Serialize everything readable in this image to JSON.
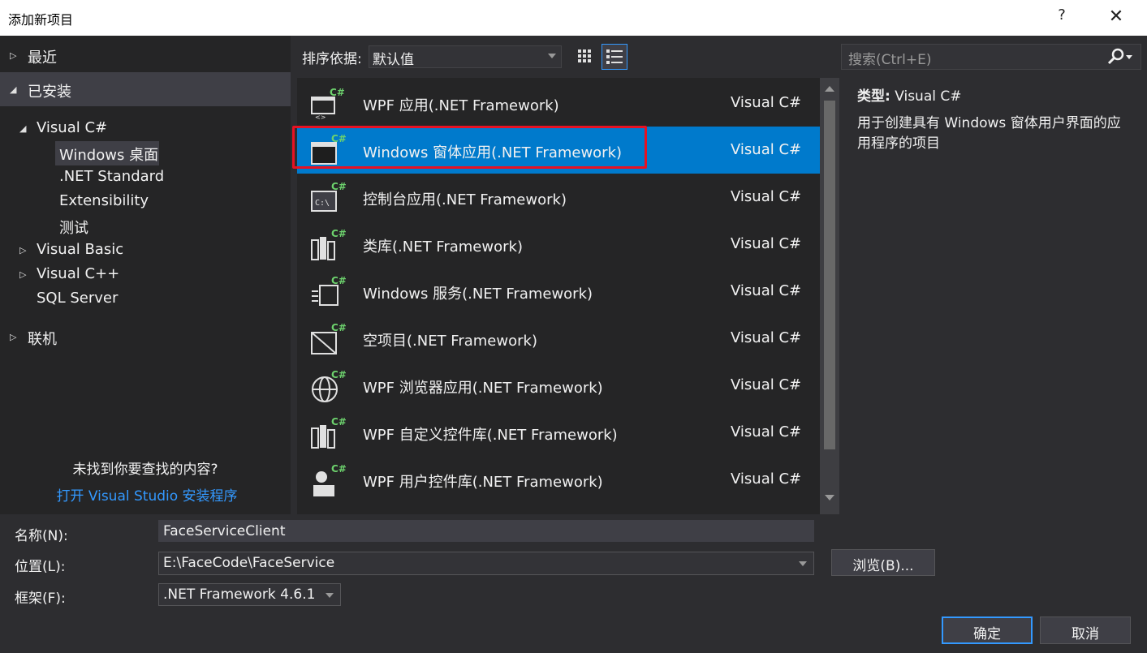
{
  "window": {
    "title": "添加新项目",
    "help_label": "?",
    "close_label": "✕"
  },
  "tree": {
    "recent": "最近",
    "installed": "已安装",
    "visual_csharp": "Visual C#",
    "windows_desktop": "Windows 桌面",
    "net_standard": ".NET Standard",
    "extensibility": "Extensibility",
    "test": "测试",
    "visual_basic": "Visual Basic",
    "visual_cpp": "Visual C++",
    "sql_server": "SQL Server",
    "online": "联机"
  },
  "left_footer": {
    "not_found": "未找到你要查找的内容?",
    "install_link": "打开 Visual Studio 安装程序"
  },
  "toolbar": {
    "sort_label": "排序依据:",
    "sort_value": "默认值"
  },
  "search": {
    "placeholder": "搜索(Ctrl+E)"
  },
  "templates": [
    {
      "name": "WPF 应用(.NET Framework)",
      "lang": "Visual C#",
      "icon": "wpf-app-icon"
    },
    {
      "name": "Windows 窗体应用(.NET Framework)",
      "lang": "Visual C#",
      "icon": "windows-forms-icon"
    },
    {
      "name": "控制台应用(.NET Framework)",
      "lang": "Visual C#",
      "icon": "console-app-icon"
    },
    {
      "name": "类库(.NET Framework)",
      "lang": "Visual C#",
      "icon": "class-library-icon"
    },
    {
      "name": "Windows 服务(.NET Framework)",
      "lang": "Visual C#",
      "icon": "windows-service-icon"
    },
    {
      "name": "空项目(.NET Framework)",
      "lang": "Visual C#",
      "icon": "empty-project-icon"
    },
    {
      "name": "WPF 浏览器应用(.NET Framework)",
      "lang": "Visual C#",
      "icon": "wpf-browser-icon"
    },
    {
      "name": "WPF 自定义控件库(.NET Framework)",
      "lang": "Visual C#",
      "icon": "wpf-custom-control-icon"
    },
    {
      "name": "WPF 用户控件库(.NET Framework)",
      "lang": "Visual C#",
      "icon": "wpf-user-control-icon"
    }
  ],
  "details": {
    "type_label": "类型:",
    "type_value": "Visual C#",
    "description": "用于创建具有 Windows 窗体用户界面的应用程序的项目"
  },
  "form": {
    "name_label": "名称(N):",
    "name_value": "FaceServiceClient",
    "location_label": "位置(L):",
    "location_value": "E:\\FaceCode\\FaceService",
    "framework_label": "框架(F):",
    "framework_value": ".NET Framework 4.6.1",
    "browse_label": "浏览(B)...",
    "ok_label": "确定",
    "cancel_label": "取消"
  },
  "colors": {
    "accent": "#007acc",
    "highlight_red": "#e81123",
    "link": "#3399ff"
  }
}
